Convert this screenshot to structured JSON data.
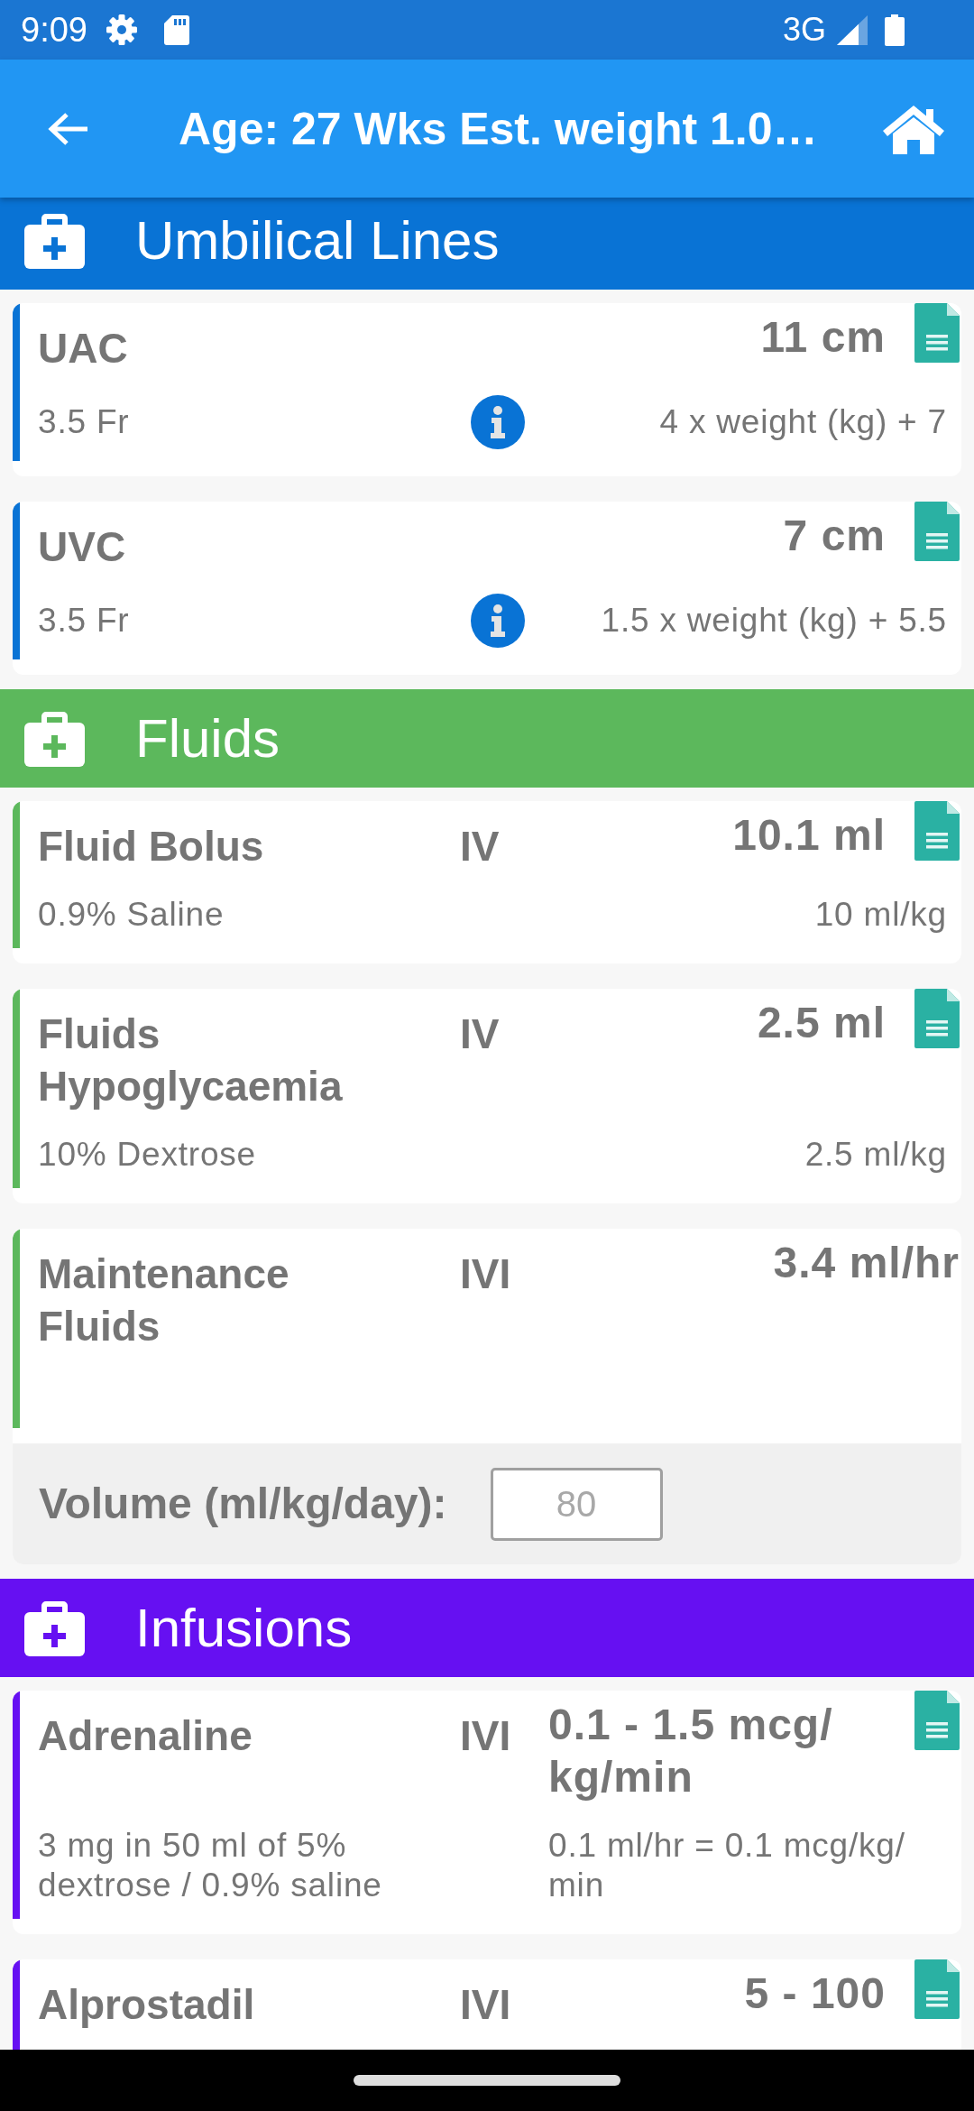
{
  "status_bar": {
    "time": "9:09",
    "network": "3G"
  },
  "app_bar": {
    "title": "Age: 27 Wks Est. weight 1.0…"
  },
  "sections": [
    {
      "title": "Umbilical Lines",
      "color": "#0973d5",
      "items": [
        {
          "name": "UAC",
          "dose": "11 cm",
          "document": true,
          "detail": "3.5 Fr",
          "info": true,
          "formula": "4 x weight (kg) + 7"
        },
        {
          "name": "UVC",
          "dose": "7 cm",
          "document": true,
          "detail": "3.5 Fr",
          "info": true,
          "formula": "1.5 x weight (kg) + 5.5"
        }
      ]
    },
    {
      "title": "Fluids",
      "color": "#5cb85c",
      "items": [
        {
          "name": "Fluid Bolus",
          "route": "IV",
          "dose": "10.1 ml",
          "document": true,
          "detail": "0.9% Saline",
          "formula": "10 ml/kg"
        },
        {
          "name": "Fluids Hypoglycaemia",
          "route": "IV",
          "dose": "2.5 ml",
          "document": true,
          "detail": "10% Dextrose",
          "formula": "2.5 ml/kg"
        },
        {
          "name": "Maintenance Fluids",
          "route": "IVI",
          "dose": "3.4 ml/hr",
          "document": false,
          "volume": {
            "label": "Volume (ml/kg/day):",
            "placeholder": "80"
          }
        }
      ]
    },
    {
      "title": "Infusions",
      "color": "#6610f2",
      "items": [
        {
          "name": "Adrenaline",
          "route": "IVI",
          "dose": "0.1 - 1.5 mcg/kg/min",
          "document": true,
          "detail": "3 mg in 50 ml of 5% dextrose / 0.9% saline",
          "formula": "0.1 ml/hr = 0.1 mcg/kg/min"
        },
        {
          "name": "Alprostadil",
          "route": "IVI",
          "dose": "5 - 100",
          "document": true
        }
      ]
    }
  ]
}
